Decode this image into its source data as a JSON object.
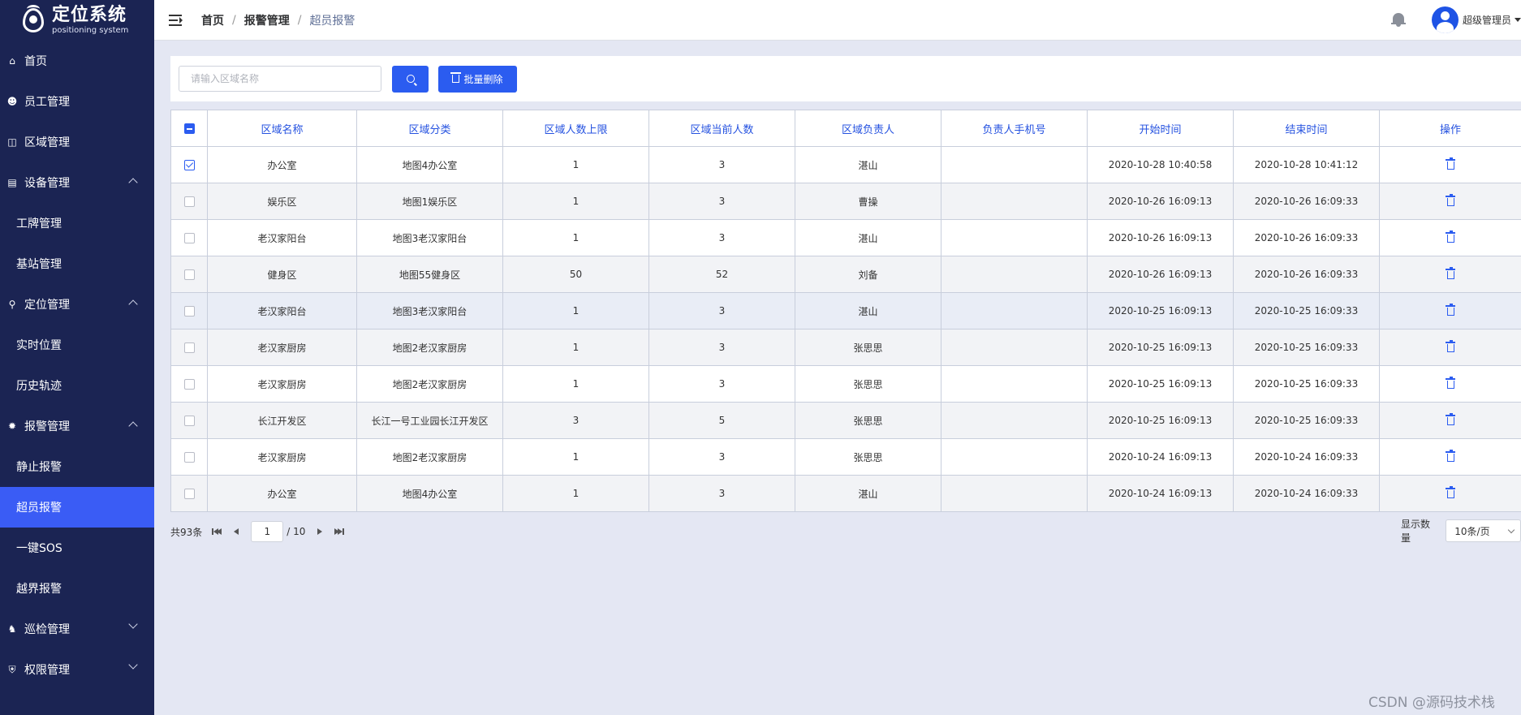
{
  "brand": {
    "title": "定位系统",
    "subtitle": "positioning system"
  },
  "sidebar": {
    "items": [
      {
        "label": "首页",
        "icon": "home-icon"
      },
      {
        "label": "员工管理",
        "icon": "users-icon"
      },
      {
        "label": "区域管理",
        "icon": "area-icon"
      },
      {
        "label": "设备管理",
        "icon": "device-icon",
        "expanded": true,
        "children": [
          "工牌管理",
          "基站管理"
        ]
      },
      {
        "label": "定位管理",
        "icon": "location-icon",
        "expanded": true,
        "children": [
          "实时位置",
          "历史轨迹"
        ]
      },
      {
        "label": "报警管理",
        "icon": "alarm-icon",
        "expanded": true,
        "children": [
          "静止报警",
          "超员报警",
          "一键SOS",
          "越界报警"
        ]
      },
      {
        "label": "巡检管理",
        "icon": "patrol-icon",
        "expanded": false
      },
      {
        "label": "权限管理",
        "icon": "shield-icon",
        "expanded": false
      }
    ],
    "active": "超员报警"
  },
  "header": {
    "breadcrumb": [
      "首页",
      "报警管理",
      "超员报警"
    ],
    "user_name": "超级管理员"
  },
  "toolbar": {
    "search_placeholder": "请输入区域名称",
    "batch_delete_label": "批量删除"
  },
  "table": {
    "columns": [
      "区域名称",
      "区域分类",
      "区域人数上限",
      "区域当前人数",
      "区域负责人",
      "负责人手机号",
      "开始时间",
      "结束时间",
      "操作"
    ],
    "rows": [
      {
        "checked": true,
        "cells": [
          "办公室",
          "地图4办公室",
          "1",
          "3",
          "湛山",
          "",
          "2020-10-28 10:40:58",
          "2020-10-28 10:41:12"
        ]
      },
      {
        "checked": false,
        "cells": [
          "娱乐区",
          "地图1娱乐区",
          "1",
          "3",
          "曹操",
          "",
          "2020-10-26 16:09:13",
          "2020-10-26 16:09:33"
        ]
      },
      {
        "checked": false,
        "cells": [
          "老汉家阳台",
          "地图3老汉家阳台",
          "1",
          "3",
          "湛山",
          "",
          "2020-10-26 16:09:13",
          "2020-10-26 16:09:33"
        ]
      },
      {
        "checked": false,
        "cells": [
          "健身区",
          "地图55健身区",
          "50",
          "52",
          "刘备",
          "",
          "2020-10-26 16:09:13",
          "2020-10-26 16:09:33"
        ]
      },
      {
        "checked": false,
        "cells": [
          "老汉家阳台",
          "地图3老汉家阳台",
          "1",
          "3",
          "湛山",
          "",
          "2020-10-25 16:09:13",
          "2020-10-25 16:09:33"
        ]
      },
      {
        "checked": false,
        "cells": [
          "老汉家厨房",
          "地图2老汉家厨房",
          "1",
          "3",
          "张思思",
          "",
          "2020-10-25 16:09:13",
          "2020-10-25 16:09:33"
        ]
      },
      {
        "checked": false,
        "cells": [
          "老汉家厨房",
          "地图2老汉家厨房",
          "1",
          "3",
          "张思思",
          "",
          "2020-10-25 16:09:13",
          "2020-10-25 16:09:33"
        ]
      },
      {
        "checked": false,
        "cells": [
          "长江开发区",
          "长江一号工业园长江开发区",
          "3",
          "5",
          "张思思",
          "",
          "2020-10-25 16:09:13",
          "2020-10-25 16:09:33"
        ]
      },
      {
        "checked": false,
        "cells": [
          "老汉家厨房",
          "地图2老汉家厨房",
          "1",
          "3",
          "张思思",
          "",
          "2020-10-24 16:09:13",
          "2020-10-24 16:09:33"
        ]
      },
      {
        "checked": false,
        "cells": [
          "办公室",
          "地图4办公室",
          "1",
          "3",
          "湛山",
          "",
          "2020-10-24 16:09:13",
          "2020-10-24 16:09:33"
        ]
      }
    ]
  },
  "pagination": {
    "total_text": "共93条",
    "current_page": "1",
    "total_pages_text": "/ 10",
    "page_size_label": "显示数量",
    "page_size_value": "10条/页"
  },
  "watermark": "CSDN @源码技术栈",
  "colors": {
    "sidebar_bg": "#1b2453",
    "accent": "#2b5cf0",
    "active_menu": "#3a5cf5"
  }
}
